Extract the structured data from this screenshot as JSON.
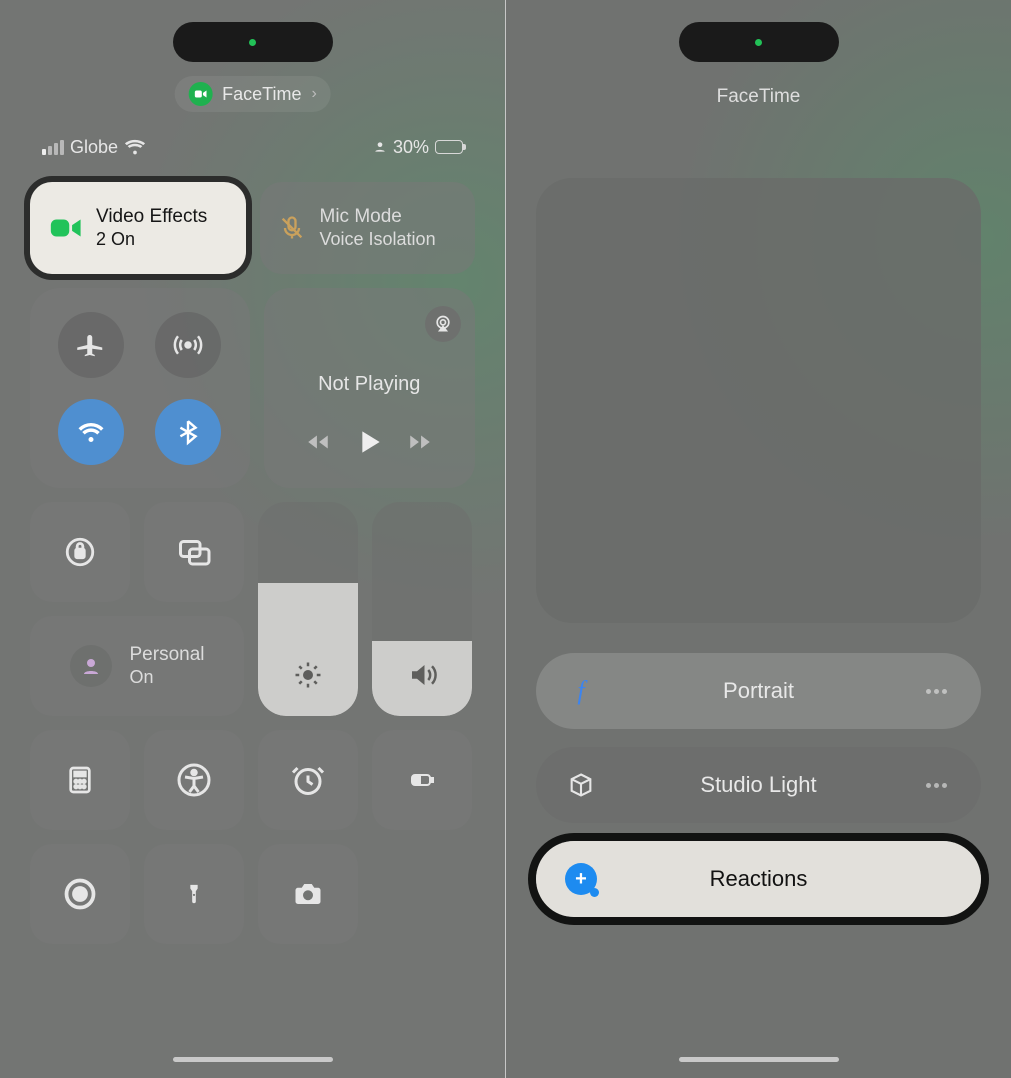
{
  "left": {
    "app_pill": {
      "label": "FaceTime"
    },
    "status": {
      "carrier": "Globe",
      "battery_pct": "30%"
    },
    "tiles": {
      "video_effects": {
        "title": "Video Effects",
        "subtitle": "2 On"
      },
      "mic_mode": {
        "title": "Mic Mode",
        "subtitle": "Voice Isolation"
      },
      "now_playing": {
        "title": "Not Playing"
      },
      "focus": {
        "title": "Personal",
        "subtitle": "On"
      }
    }
  },
  "right": {
    "app_title": "FaceTime",
    "rows": {
      "portrait": "Portrait",
      "studio_light": "Studio Light",
      "reactions": "Reactions"
    }
  }
}
